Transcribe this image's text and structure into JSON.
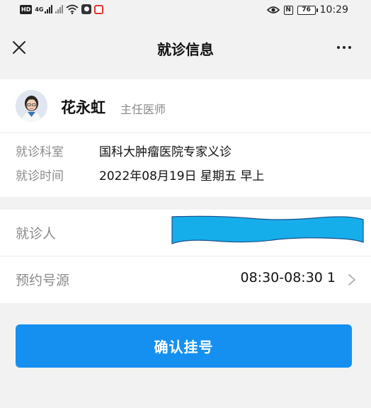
{
  "status_bar": {
    "hd_label": "HD",
    "network_label": "4G",
    "battery": "76",
    "time": "10:29",
    "icons": [
      "hd-icon",
      "signal-icon",
      "wifi-icon",
      "app-icon",
      "notification-icon",
      "eye-icon",
      "nfc-icon",
      "battery-icon"
    ]
  },
  "nav": {
    "title": "就诊信息",
    "close_icon": "close-icon",
    "more_icon": "more-icon"
  },
  "doctor": {
    "name": "花永虹",
    "title": "主任医师"
  },
  "visit": {
    "dept_label": "就诊科室",
    "dept_value": "国科大肿瘤医院专家义诊",
    "time_label": "就诊时间",
    "time_value": "2022年08月19日 星期五 早上"
  },
  "form": {
    "patient_label": "就诊人",
    "slot_label": "预约号源",
    "slot_value": "08:30-08:30 1"
  },
  "actions": {
    "confirm_label": "确认挂号"
  },
  "colors": {
    "accent": "#1590f1",
    "redaction": "#16aeea"
  }
}
